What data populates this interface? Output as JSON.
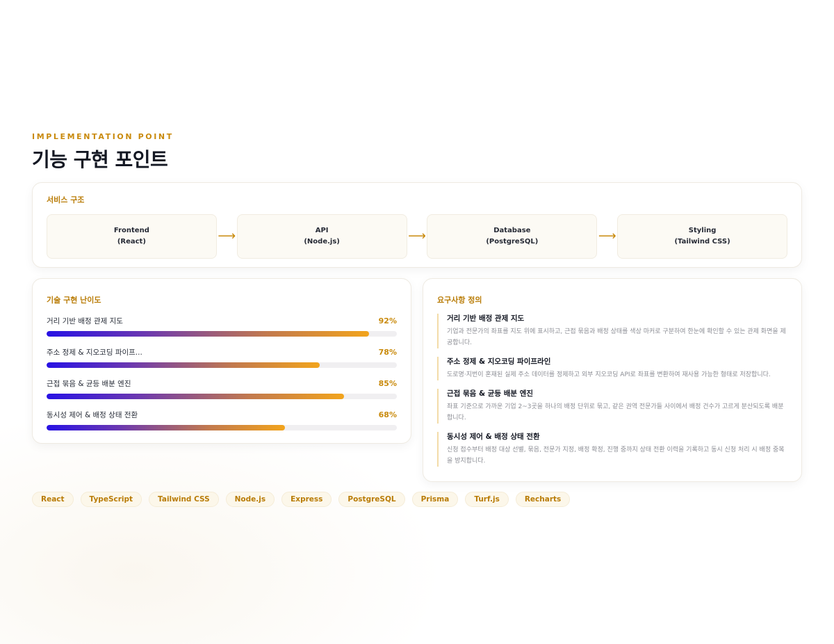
{
  "eyebrow": "IMPLEMENTATION POINT",
  "title": "기능 구현 포인트",
  "architecture": {
    "title": "서비스 구조",
    "nodes": [
      {
        "name": "Frontend",
        "tech": "(React)"
      },
      {
        "name": "API",
        "tech": "(Node.js)"
      },
      {
        "name": "Database",
        "tech": "(PostgreSQL)"
      },
      {
        "name": "Styling",
        "tech": "(Tailwind CSS)"
      }
    ],
    "arrow": "⟶"
  },
  "difficulty": {
    "title": "기술 구현 난이도",
    "items": [
      {
        "label": "거리 기반 배정 관제 지도",
        "percent": "92%",
        "value": 92
      },
      {
        "label": "주소 정제 & 지오코딩 파이프...",
        "percent": "78%",
        "value": 78
      },
      {
        "label": "근접 묶음 & 균등 배분 엔진",
        "percent": "85%",
        "value": 85
      },
      {
        "label": "동시성 제어 & 배정 상태 전환",
        "percent": "68%",
        "value": 68
      }
    ]
  },
  "requirements": {
    "title": "요구사항 정의",
    "items": [
      {
        "title": "거리 기반 배정 관제 지도",
        "desc": "기업과 전문가의 좌표를 지도 위에 표시하고, 근접 묶음과 배정 상태를 색상 마커로 구분하여 한눈에 확인할 수 있는 관제 화면을 제공합니다."
      },
      {
        "title": "주소 정제 & 지오코딩 파이프라인",
        "desc": "도로명·지번이 혼재된 실제 주소 데이터를 정제하고 외부 지오코딩 API로 좌표를 변환하여 재사용 가능한 형태로 저장합니다."
      },
      {
        "title": "근접 묶음 & 균등 배분 엔진",
        "desc": "좌표 기준으로 가까운 기업 2~3곳을 하나의 배정 단위로 묶고, 같은 권역 전문가들 사이에서 배정 건수가 고르게 분산되도록 배분합니다."
      },
      {
        "title": "동시성 제어 & 배정 상태 전환",
        "desc": "신청 접수부터 배정 대상 선별, 묶음, 전문가 지정, 배정 확정, 진행 중까지 상태 전환 이력을 기록하고 동시 신청 처리 시 배정 중복을 방지합니다."
      }
    ]
  },
  "tags": [
    "React",
    "TypeScript",
    "Tailwind CSS",
    "Node.js",
    "Express",
    "PostgreSQL",
    "Prisma",
    "Turf.js",
    "Recharts"
  ],
  "colors": {
    "accent": "#c98a0c",
    "gradient_start": "#2812e4",
    "gradient_end": "#f2a41c"
  }
}
